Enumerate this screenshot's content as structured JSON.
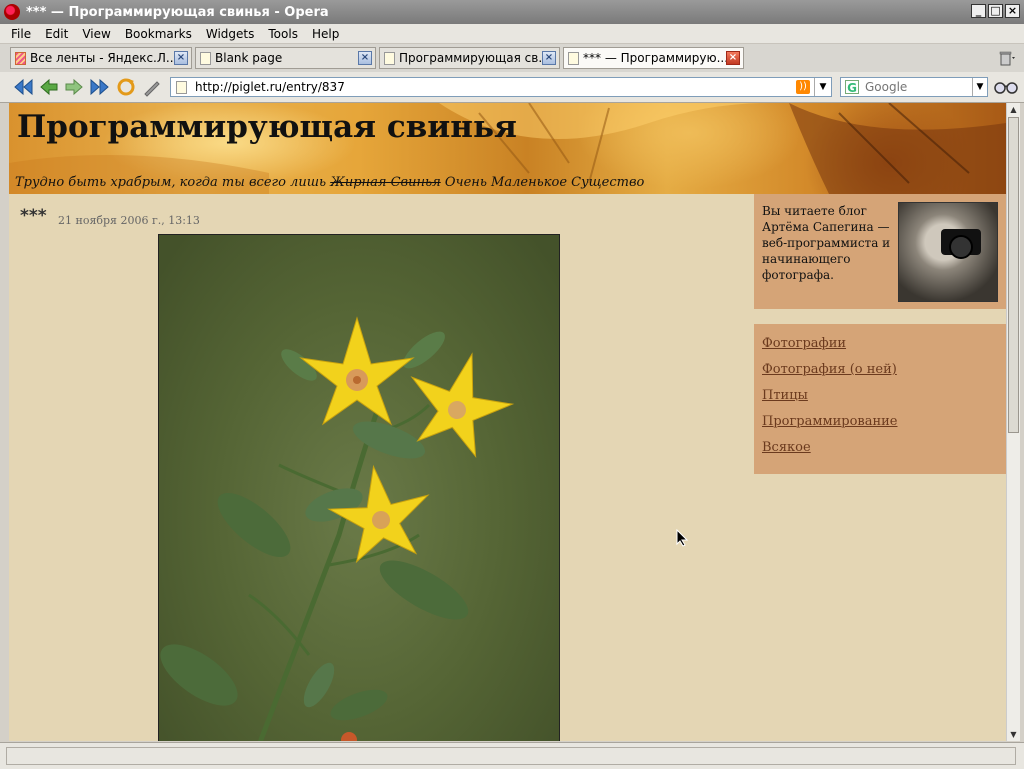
{
  "window": {
    "title": "*** — Программирующая свинья - Opera"
  },
  "menu": [
    "File",
    "Edit",
    "View",
    "Bookmarks",
    "Widgets",
    "Tools",
    "Help"
  ],
  "tabs": [
    {
      "label": "Все ленты - Яндекс.Л...",
      "icon": "rss-feed-icon",
      "active": false
    },
    {
      "label": "Blank page",
      "icon": "page-icon",
      "active": false
    },
    {
      "label": "Программирующая св...",
      "icon": "page-icon",
      "active": false
    },
    {
      "label": "*** — Программирую...",
      "icon": "page-icon",
      "active": true
    }
  ],
  "nav": {
    "url": "http://piglet.ru/entry/837",
    "search_placeholder": "Google"
  },
  "blog": {
    "title": "Программирующая свинья",
    "tagline_start": "Трудно быть храбрым, когда ты всего лишь ",
    "tagline_struck": "Жирная Свинья",
    "tagline_end": " Очень Маленькое Существо"
  },
  "post": {
    "title": "***",
    "date": "21 ноября 2006 г., 13:13"
  },
  "sidebar": {
    "about": "Вы читаете блог Артёма Сапегина — веб-программиста и начинающего фотографа.",
    "links": [
      "Фотографии",
      "Фотография (о ней)",
      "Птицы",
      "Программирование",
      "Всякое"
    ]
  },
  "colors": {
    "page_bg": "#e4d6b4",
    "sidebar_bg": "#d5a477",
    "link": "#6b3a1e"
  }
}
